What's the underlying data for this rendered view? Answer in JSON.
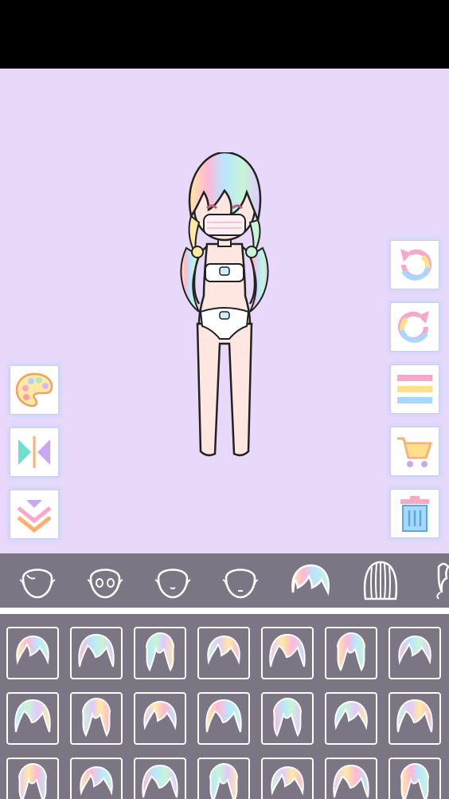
{
  "colors": {
    "background": "#e8d9fb",
    "panel": "#7c7584",
    "top_bar": "#000000",
    "hair_pastels": [
      "#ffe9a3",
      "#ffb8d6",
      "#b8e6ff",
      "#c8f5d6",
      "#e2c8ff"
    ]
  },
  "stage": {
    "left_tools": [
      {
        "name": "palette-button",
        "icon": "palette-icon"
      },
      {
        "name": "flip-button",
        "icon": "flip-icon"
      },
      {
        "name": "layer-down-button",
        "icon": "chevrons-down-icon"
      }
    ],
    "right_tools": [
      {
        "name": "undo-button",
        "icon": "undo-icon"
      },
      {
        "name": "redo-button",
        "icon": "redo-icon"
      },
      {
        "name": "menu-button",
        "icon": "hamburger-menu-icon"
      },
      {
        "name": "shop-button",
        "icon": "cart-icon"
      },
      {
        "name": "delete-button",
        "icon": "trash-icon"
      }
    ]
  },
  "categories": [
    {
      "name": "category-face-shape",
      "icon": "face-outline-icon"
    },
    {
      "name": "category-eyes",
      "icon": "face-eyes-icon"
    },
    {
      "name": "category-nose",
      "icon": "face-nose-icon"
    },
    {
      "name": "category-mouth",
      "icon": "face-mouth-icon"
    },
    {
      "name": "category-front-hair",
      "icon": "front-hair-icon",
      "selected": true
    },
    {
      "name": "category-back-hair",
      "icon": "back-hair-icon"
    },
    {
      "name": "category-accessory",
      "icon": "accessory-icon"
    }
  ],
  "hair_items": {
    "rows": 3,
    "cols": 7,
    "styles": [
      "bob",
      "twin-tail",
      "braid-side",
      "short-bangs",
      "curly-twin",
      "short-layer",
      "straight-bob",
      "bob-wave",
      "double-braid",
      "long-straight",
      "wavy-long",
      "hime-cut",
      "short-flip",
      "blunt-bob",
      "fluffy-bun",
      "messy-short",
      "side-swept",
      "round-bob",
      "volume-top",
      "soft-short",
      "spiky-short"
    ]
  }
}
